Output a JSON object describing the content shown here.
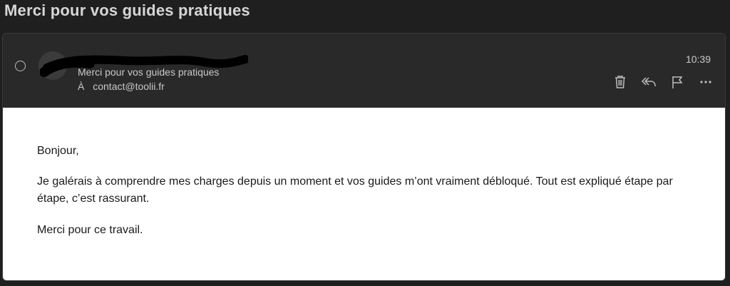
{
  "subject": "Merci pour vos guides pratiques",
  "header": {
    "time": "10:39",
    "preview": "Merci pour vos guides pratiques",
    "to_label": "À",
    "to_address": "contact@toolii.fr"
  },
  "actions": {
    "delete": "trash-icon",
    "reply": "reply-icon",
    "flag": "flag-icon",
    "more": "more-icon"
  },
  "body": {
    "greeting": "Bonjour,",
    "paragraph": "Je galérais à comprendre mes charges depuis un moment et vos guides m’ont vraiment débloqué. Tout est expliqué étape par étape, c’est rassurant.",
    "closing": "Merci pour ce travail."
  },
  "colors": {
    "background": "#1f1f1f",
    "header": "#292929",
    "body": "#ffffff"
  }
}
